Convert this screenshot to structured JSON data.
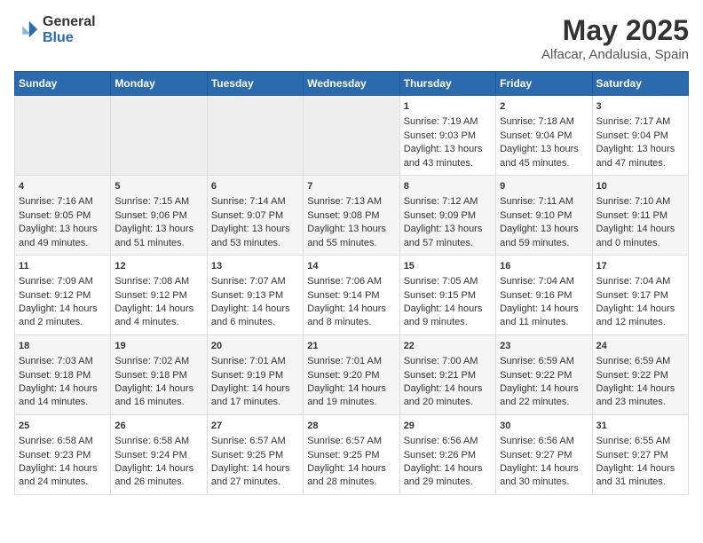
{
  "logo": {
    "general": "General",
    "blue": "Blue"
  },
  "title": "May 2025",
  "subtitle": "Alfacar, Andalusia, Spain",
  "days_of_week": [
    "Sunday",
    "Monday",
    "Tuesday",
    "Wednesday",
    "Thursday",
    "Friday",
    "Saturday"
  ],
  "weeks": [
    [
      {
        "num": "",
        "info": ""
      },
      {
        "num": "",
        "info": ""
      },
      {
        "num": "",
        "info": ""
      },
      {
        "num": "",
        "info": ""
      },
      {
        "num": "1",
        "info": "Sunrise: 7:19 AM\nSunset: 9:03 PM\nDaylight: 13 hours\nand 43 minutes."
      },
      {
        "num": "2",
        "info": "Sunrise: 7:18 AM\nSunset: 9:04 PM\nDaylight: 13 hours\nand 45 minutes."
      },
      {
        "num": "3",
        "info": "Sunrise: 7:17 AM\nSunset: 9:04 PM\nDaylight: 13 hours\nand 47 minutes."
      }
    ],
    [
      {
        "num": "4",
        "info": "Sunrise: 7:16 AM\nSunset: 9:05 PM\nDaylight: 13 hours\nand 49 minutes."
      },
      {
        "num": "5",
        "info": "Sunrise: 7:15 AM\nSunset: 9:06 PM\nDaylight: 13 hours\nand 51 minutes."
      },
      {
        "num": "6",
        "info": "Sunrise: 7:14 AM\nSunset: 9:07 PM\nDaylight: 13 hours\nand 53 minutes."
      },
      {
        "num": "7",
        "info": "Sunrise: 7:13 AM\nSunset: 9:08 PM\nDaylight: 13 hours\nand 55 minutes."
      },
      {
        "num": "8",
        "info": "Sunrise: 7:12 AM\nSunset: 9:09 PM\nDaylight: 13 hours\nand 57 minutes."
      },
      {
        "num": "9",
        "info": "Sunrise: 7:11 AM\nSunset: 9:10 PM\nDaylight: 13 hours\nand 59 minutes."
      },
      {
        "num": "10",
        "info": "Sunrise: 7:10 AM\nSunset: 9:11 PM\nDaylight: 14 hours\nand 0 minutes."
      }
    ],
    [
      {
        "num": "11",
        "info": "Sunrise: 7:09 AM\nSunset: 9:12 PM\nDaylight: 14 hours\nand 2 minutes."
      },
      {
        "num": "12",
        "info": "Sunrise: 7:08 AM\nSunset: 9:12 PM\nDaylight: 14 hours\nand 4 minutes."
      },
      {
        "num": "13",
        "info": "Sunrise: 7:07 AM\nSunset: 9:13 PM\nDaylight: 14 hours\nand 6 minutes."
      },
      {
        "num": "14",
        "info": "Sunrise: 7:06 AM\nSunset: 9:14 PM\nDaylight: 14 hours\nand 8 minutes."
      },
      {
        "num": "15",
        "info": "Sunrise: 7:05 AM\nSunset: 9:15 PM\nDaylight: 14 hours\nand 9 minutes."
      },
      {
        "num": "16",
        "info": "Sunrise: 7:04 AM\nSunset: 9:16 PM\nDaylight: 14 hours\nand 11 minutes."
      },
      {
        "num": "17",
        "info": "Sunrise: 7:04 AM\nSunset: 9:17 PM\nDaylight: 14 hours\nand 12 minutes."
      }
    ],
    [
      {
        "num": "18",
        "info": "Sunrise: 7:03 AM\nSunset: 9:18 PM\nDaylight: 14 hours\nand 14 minutes."
      },
      {
        "num": "19",
        "info": "Sunrise: 7:02 AM\nSunset: 9:18 PM\nDaylight: 14 hours\nand 16 minutes."
      },
      {
        "num": "20",
        "info": "Sunrise: 7:01 AM\nSunset: 9:19 PM\nDaylight: 14 hours\nand 17 minutes."
      },
      {
        "num": "21",
        "info": "Sunrise: 7:01 AM\nSunset: 9:20 PM\nDaylight: 14 hours\nand 19 minutes."
      },
      {
        "num": "22",
        "info": "Sunrise: 7:00 AM\nSunset: 9:21 PM\nDaylight: 14 hours\nand 20 minutes."
      },
      {
        "num": "23",
        "info": "Sunrise: 6:59 AM\nSunset: 9:22 PM\nDaylight: 14 hours\nand 22 minutes."
      },
      {
        "num": "24",
        "info": "Sunrise: 6:59 AM\nSunset: 9:22 PM\nDaylight: 14 hours\nand 23 minutes."
      }
    ],
    [
      {
        "num": "25",
        "info": "Sunrise: 6:58 AM\nSunset: 9:23 PM\nDaylight: 14 hours\nand 24 minutes."
      },
      {
        "num": "26",
        "info": "Sunrise: 6:58 AM\nSunset: 9:24 PM\nDaylight: 14 hours\nand 26 minutes."
      },
      {
        "num": "27",
        "info": "Sunrise: 6:57 AM\nSunset: 9:25 PM\nDaylight: 14 hours\nand 27 minutes."
      },
      {
        "num": "28",
        "info": "Sunrise: 6:57 AM\nSunset: 9:25 PM\nDaylight: 14 hours\nand 28 minutes."
      },
      {
        "num": "29",
        "info": "Sunrise: 6:56 AM\nSunset: 9:26 PM\nDaylight: 14 hours\nand 29 minutes."
      },
      {
        "num": "30",
        "info": "Sunrise: 6:56 AM\nSunset: 9:27 PM\nDaylight: 14 hours\nand 30 minutes."
      },
      {
        "num": "31",
        "info": "Sunrise: 6:55 AM\nSunset: 9:27 PM\nDaylight: 14 hours\nand 31 minutes."
      }
    ]
  ]
}
